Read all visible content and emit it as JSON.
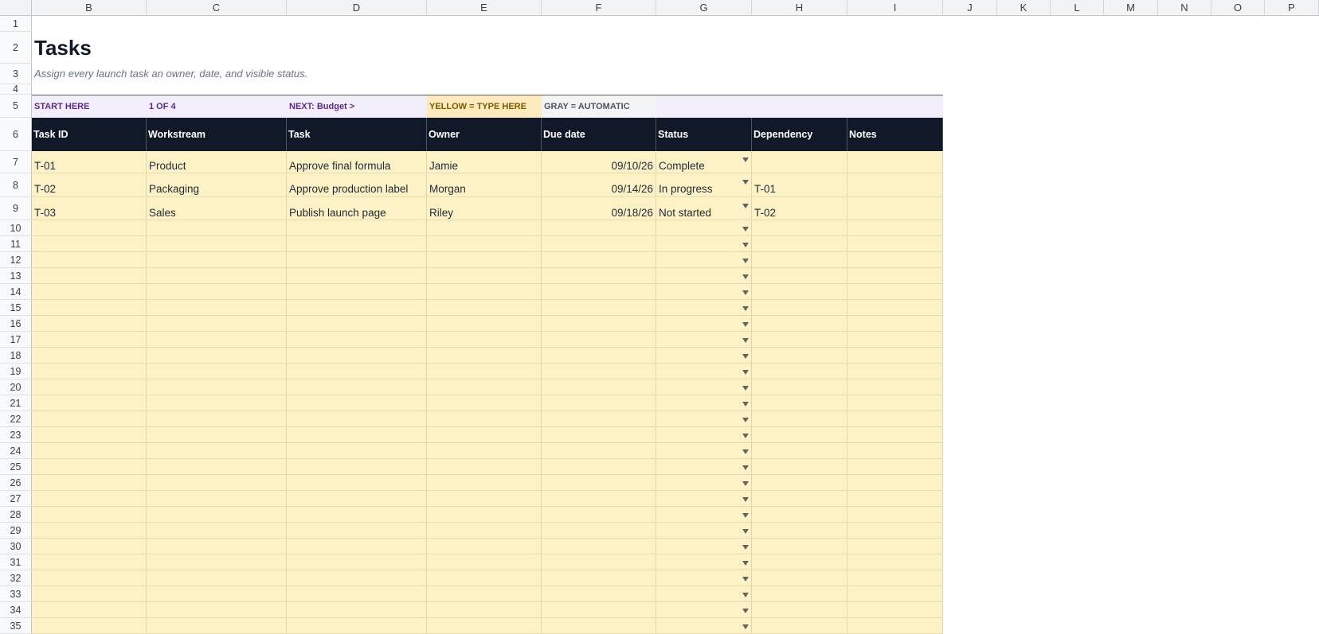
{
  "columns": [
    "B",
    "C",
    "D",
    "E",
    "F",
    "G",
    "H",
    "I",
    "J",
    "K",
    "L",
    "M",
    "N",
    "O",
    "P"
  ],
  "title": "Tasks",
  "subtitle": "Assign every launch task an owner, date, and visible status.",
  "nav": {
    "start": "START HERE",
    "step": "1 OF 4",
    "next": "NEXT: Budget  >",
    "yellow_legend": "YELLOW = TYPE HERE",
    "gray_legend": "GRAY = AUTOMATIC"
  },
  "headers": [
    "Task ID",
    "Workstream",
    "Task",
    "Owner",
    "Due date",
    "Status",
    "Dependency",
    "Notes"
  ],
  "rows": [
    [
      "T-01",
      "Product",
      "Approve final formula",
      "Jamie",
      "09/10/26",
      "Complete",
      "",
      ""
    ],
    [
      "T-02",
      "Packaging",
      "Approve production label",
      "Morgan",
      "09/14/26",
      "In progress",
      "T-01",
      ""
    ],
    [
      "T-03",
      "Sales",
      "Publish launch page",
      "Riley",
      "09/18/26",
      "Not started",
      "T-02",
      ""
    ]
  ],
  "colors": {
    "header_bg": "#111827",
    "input_yellow": "#fdf2c6",
    "nav_lavender": "#f3eefc",
    "accent_purple": "#7b3fb8"
  },
  "icons": {
    "status_dropdown": "triangle-down-icon"
  }
}
